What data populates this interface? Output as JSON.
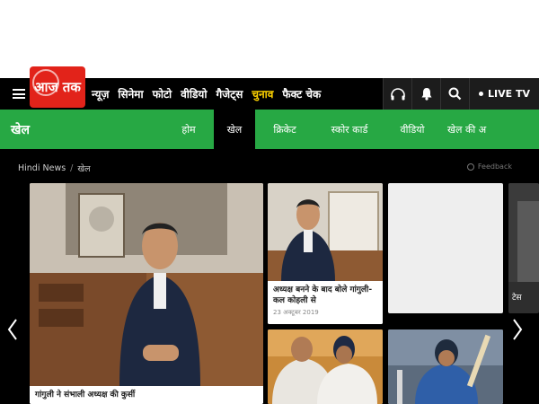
{
  "brand": {
    "logo_text": "आज तक",
    "color": "#e2231a"
  },
  "nav": {
    "links": [
      {
        "label": "न्यूज़"
      },
      {
        "label": "सिनेमा"
      },
      {
        "label": "फोटो"
      },
      {
        "label": "वीडियो"
      },
      {
        "label": "गैजेट्स"
      },
      {
        "label": "चुनाव",
        "highlight": true
      },
      {
        "label": "फैक्ट चेक"
      }
    ],
    "live_label": "LIVE TV",
    "icons": [
      "headphones-icon",
      "bell-icon",
      "search-icon"
    ]
  },
  "section": {
    "title": "खेल",
    "tabs": [
      {
        "label": "होम"
      },
      {
        "label": "खेल",
        "active": true
      },
      {
        "label": "क्रिकेट"
      },
      {
        "label": "स्कोर कार्ड"
      },
      {
        "label": "वीडियो"
      },
      {
        "label": "खेल की अ"
      }
    ],
    "accent": "#27a844"
  },
  "breadcrumb": {
    "home": "Hindi News",
    "current": "खेल"
  },
  "feedback_label": "Feedback",
  "cards": {
    "featured": {
      "title": "गांगुली ने संभाली अध्यक्ष की कुर्सी"
    },
    "story1": {
      "title": "अध्यक्ष बनने के बाद बोले गांगुली- कल कोहली से",
      "date": "23 अक्टूबर 2019"
    },
    "story_edge": {
      "title": "टेस"
    }
  }
}
